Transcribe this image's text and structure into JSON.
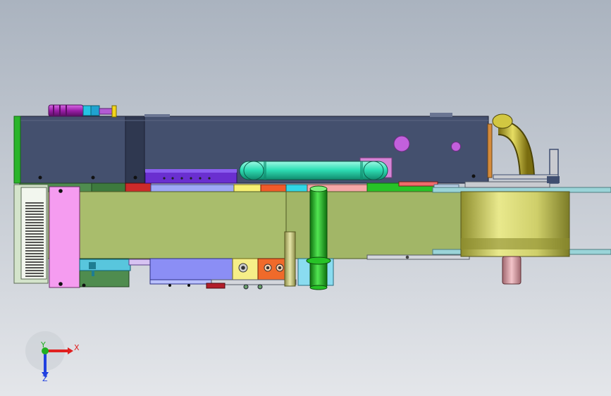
{
  "viewport": {
    "background_top": "#aab3bf",
    "background_bottom": "#e4e6ea"
  },
  "triad": {
    "x_label": "X",
    "y_label": "Y",
    "z_label": "Z",
    "x_color": "#e02020",
    "y_color": "#20b020",
    "z_color": "#2040e0"
  },
  "palette": {
    "housing": "#44506e",
    "olive_frame": "#a9bd6c",
    "pink_plate": "#f59cf0",
    "cyan_tube": "#2fe0b6",
    "gold_drum": "#cfcf6a",
    "green_post": "#27c227",
    "purple_block": "#8b8ef5",
    "magenta_motor": "#9b1fa8"
  }
}
